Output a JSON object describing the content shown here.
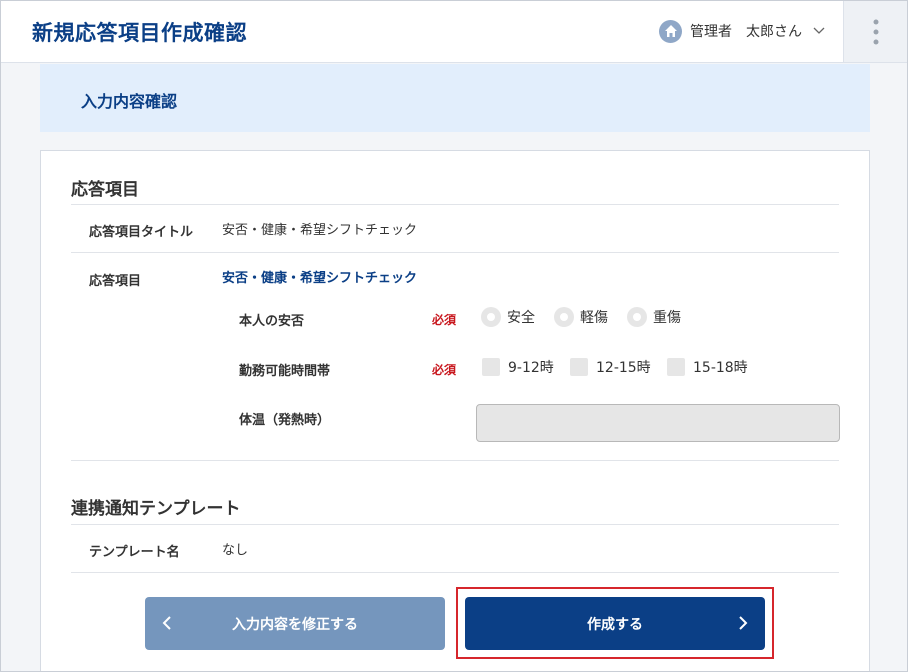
{
  "header": {
    "title": "新規応答項目作成確認",
    "role": "管理者",
    "user_name": "太郎さん",
    "home_icon": "home-icon",
    "dropdown_icon": "chevron-down-icon",
    "menu_icon": "kebab-menu-icon"
  },
  "banner": {
    "title": "入力内容確認"
  },
  "response_section": {
    "heading": "応答項目",
    "title_label": "応答項目タイトル",
    "title_value": "安否・健康・希望シフトチェック",
    "items_label": "応答項目",
    "items_value": "安否・健康・希望シフトチェック",
    "questions": [
      {
        "label": "本人の安否",
        "required": "必須",
        "type": "radio",
        "options": [
          "安全",
          "軽傷",
          "重傷"
        ]
      },
      {
        "label": "勤務可能時間帯",
        "required": "必須",
        "type": "checkbox",
        "options": [
          "9-12時",
          "12-15時",
          "15-18時"
        ]
      },
      {
        "label": "体温（発熱時）",
        "type": "text",
        "value": ""
      }
    ]
  },
  "template_section": {
    "heading": "連携通知テンプレート",
    "template_label": "テンプレート名",
    "template_value": "なし"
  },
  "actions": {
    "back_label": "入力内容を修正する",
    "create_label": "作成する"
  },
  "colors": {
    "brand": "#0b3f86",
    "required": "#c8171e",
    "back_button": "#7596bd",
    "highlight": "#d6262c"
  }
}
